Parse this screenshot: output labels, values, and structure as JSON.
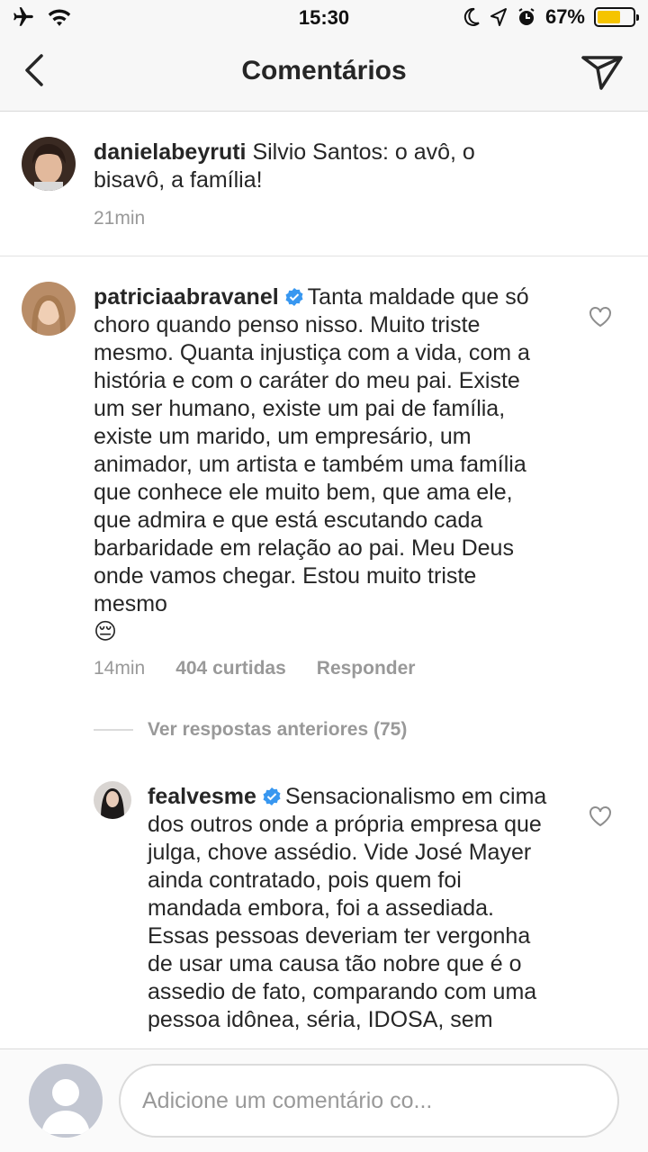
{
  "status_bar": {
    "time": "15:30",
    "battery_percent": "67%",
    "battery_level": 0.67,
    "icons": [
      "airplane-icon",
      "wifi-icon",
      "moon-icon",
      "location-icon",
      "alarm-icon",
      "battery-icon"
    ]
  },
  "nav": {
    "title": "Comentários",
    "back_icon": "chevron-left-icon",
    "send_icon": "paper-plane-icon"
  },
  "caption": {
    "username": "danielabeyruti",
    "text": "Silvio Santos: o avô, o bisavô, a família!",
    "time": "21min"
  },
  "comments": [
    {
      "username": "patriciaabravanel",
      "verified": true,
      "text": "Tanta maldade que só choro quando penso nisso. Muito triste mesmo. Quanta injustiça com a vida, com a história e com o caráter do meu pai. Existe um ser humano, existe um pai de família, existe um marido, um empresário, um animador, um artista e também uma família que conhece ele muito bem, que ama ele, que admira e que está escutando cada barbaridade em relação ao pai. Meu Deus onde vamos chegar. Estou muito triste mesmo",
      "emoji": "😔",
      "time": "14min",
      "likes": "404 curtidas",
      "reply_label": "Responder"
    }
  ],
  "replies_link": "Ver respostas anteriores (75)",
  "reply": {
    "username": "fealvesme",
    "verified": true,
    "text": "Sensacionalismo em cima dos outros onde a própria empresa que julga, chove assédio. Vide José Mayer ainda contratado, pois quem foi mandada embora, foi a assediada. Essas pessoas deveriam ter vergonha de usar uma causa tão nobre que é o assedio de fato, comparando com uma pessoa idônea, séria, IDOSA, sem"
  },
  "composer": {
    "placeholder": "Adicione um comentário co..."
  },
  "colors": {
    "verified": "#3897f0",
    "battery": "#f5c400",
    "secondary_text": "#999999"
  }
}
